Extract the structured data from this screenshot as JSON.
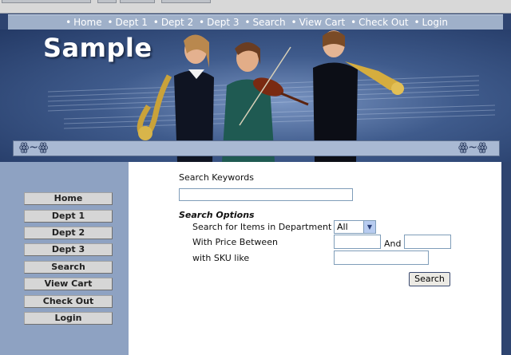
{
  "top_nav": [
    "Home",
    "Dept 1",
    "Dept 2",
    "Dept 3",
    "Search",
    "View Cart",
    "Check Out",
    "Login"
  ],
  "logo_text": "Sample",
  "sidebar": {
    "items": [
      "Home",
      "Dept 1",
      "Dept 2",
      "Dept 3",
      "Search",
      "View Cart",
      "Check Out",
      "Login"
    ]
  },
  "search": {
    "keywords_label": "Search Keywords",
    "keywords_value": "",
    "options_heading": "Search Options",
    "department_label": "Search for Items in Department",
    "department_value": "All",
    "price_label": "With Price Between",
    "price_and": "And",
    "price_from": "",
    "price_to": "",
    "sku_label": "with SKU like",
    "sku_value": "",
    "button_label": "Search"
  },
  "colors": {
    "nav_bar": "#9fb0c9",
    "sidebar_bg": "#8ea2c2",
    "page_bg": "#2e4470"
  }
}
